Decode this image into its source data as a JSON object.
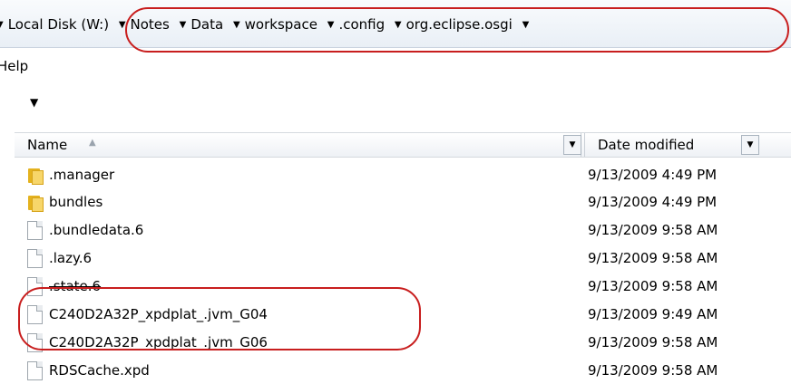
{
  "address_bar": {
    "crumbs": [
      {
        "label": "Local Disk (W:)"
      },
      {
        "label": "Notes"
      },
      {
        "label": "Data"
      },
      {
        "label": "workspace"
      },
      {
        "label": ".config"
      },
      {
        "label": "org.eclipse.osgi"
      }
    ]
  },
  "menu": {
    "help": "Help"
  },
  "columns": {
    "name": "Name",
    "date_modified": "Date modified"
  },
  "files": [
    {
      "name": ".manager",
      "date": "9/13/2009 4:49 PM",
      "type": "folder"
    },
    {
      "name": "bundles",
      "date": "9/13/2009 4:49 PM",
      "type": "folder"
    },
    {
      "name": ".bundledata.6",
      "date": "9/13/2009 9:58 AM",
      "type": "file"
    },
    {
      "name": ".lazy.6",
      "date": "9/13/2009 9:58 AM",
      "type": "file"
    },
    {
      "name": ".state.6",
      "date": "9/13/2009 9:58 AM",
      "type": "file"
    },
    {
      "name": "C240D2A32P_xpdplat_.jvm_G04",
      "date": "9/13/2009 9:49 AM",
      "type": "file"
    },
    {
      "name": "C240D2A32P_xpdplat_.jvm_G06",
      "date": "9/13/2009 9:58 AM",
      "type": "file"
    },
    {
      "name": "RDSCache.xpd",
      "date": "9/13/2009 9:58 AM",
      "type": "file"
    }
  ],
  "colors": {
    "annotation": "#c81e1e",
    "folder": "#e4b21e"
  }
}
